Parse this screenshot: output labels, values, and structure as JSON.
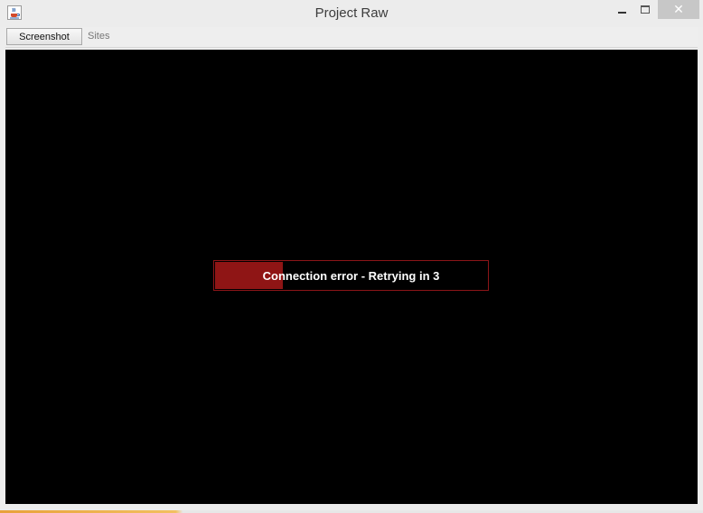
{
  "window": {
    "title": "Project Raw",
    "app_icon": "java-cup-icon",
    "controls": {
      "minimize_icon": "minimize-icon",
      "maximize_icon": "maximize-icon",
      "close_icon": "close-icon",
      "close_glyph": "✕"
    }
  },
  "toolbar": {
    "screenshot_label": "Screenshot",
    "sites_label": "Sites"
  },
  "status": {
    "message": "Connection error - Retrying in 3",
    "progress_fraction": 0.25,
    "bar_color": "#8f1515",
    "border_color": "#8b1518"
  },
  "colors": {
    "canvas_background": "#000000",
    "close_button": "#c7c7c7"
  }
}
